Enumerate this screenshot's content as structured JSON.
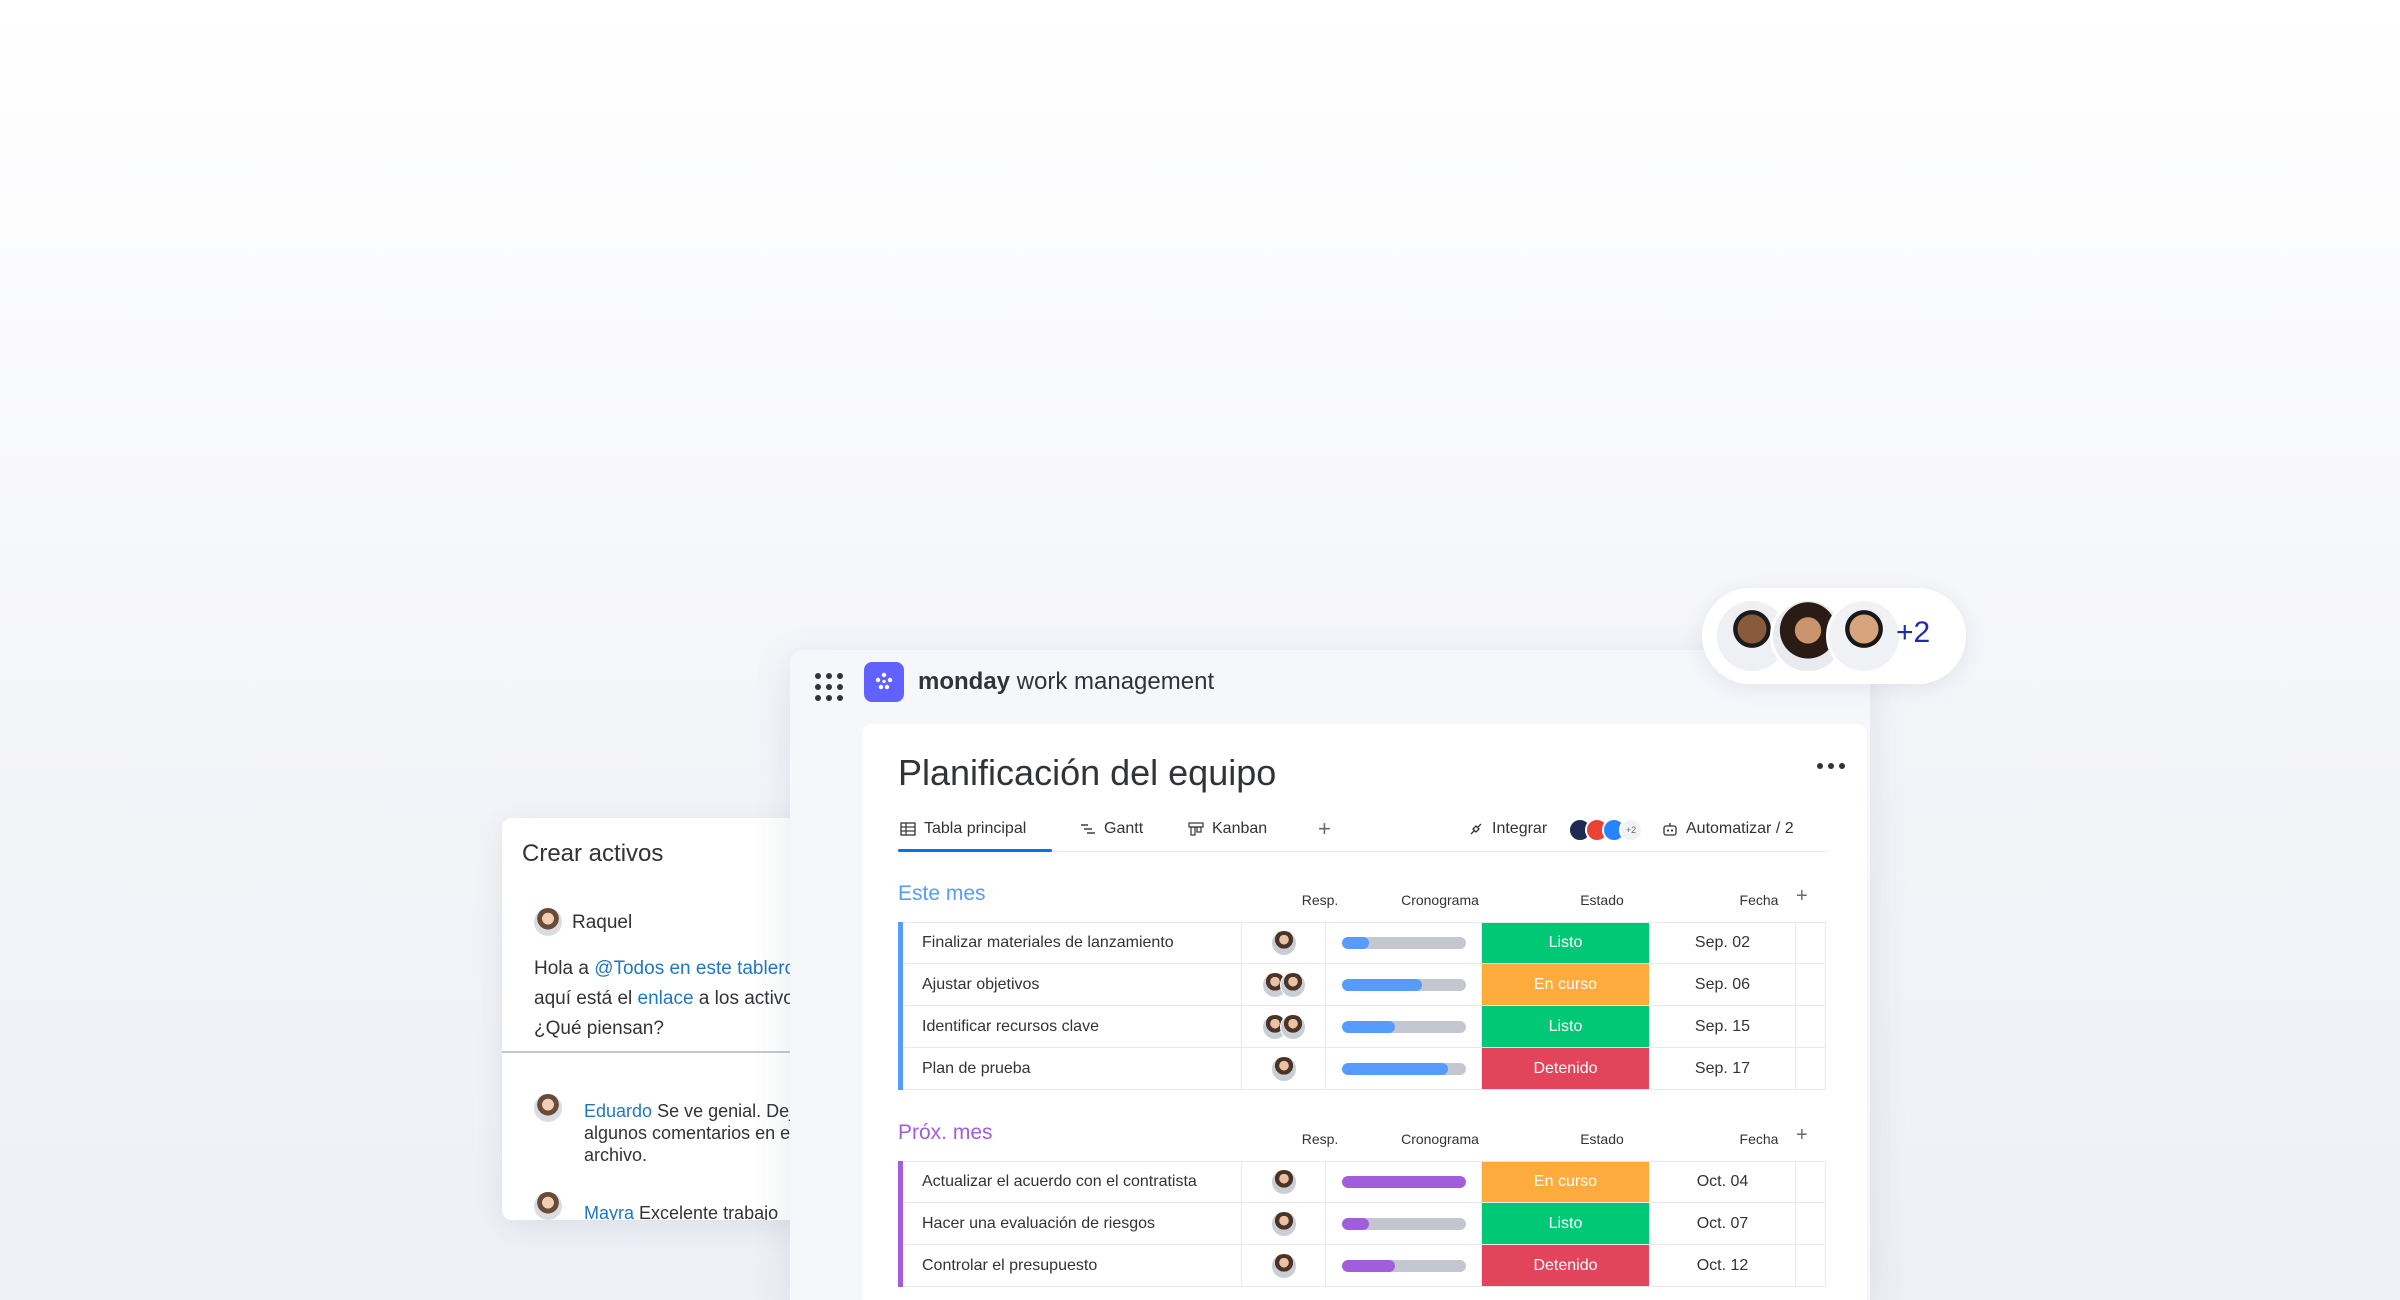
{
  "app": {
    "brand_bold": "monday",
    "brand_rest": " work management",
    "brand_color": "#6161ff"
  },
  "board": {
    "title": "Planificación del equipo",
    "tabs": [
      {
        "label": "Tabla principal",
        "icon": "table-icon",
        "active": true
      },
      {
        "label": "Gantt",
        "icon": "gantt-icon",
        "active": false
      },
      {
        "label": "Kanban",
        "icon": "kanban-icon",
        "active": false
      }
    ],
    "add_tab": "+",
    "integrate_label": "Integrar",
    "integration_extra": "+2",
    "automate_label": "Automatizar / 2",
    "columns": {
      "resp": "Resp.",
      "crono": "Cronograma",
      "estado": "Estado",
      "fecha": "Fecha",
      "add": "+"
    },
    "groups": [
      {
        "title": "Este mes",
        "color": "#579bfc",
        "rows": [
          {
            "name": "Finalizar materiales de lanzamiento",
            "people": 1,
            "progress": 0.22,
            "status": "Listo",
            "status_color": "#00c875",
            "date": "Sep. 02"
          },
          {
            "name": "Ajustar objetivos",
            "people": 2,
            "progress": 0.65,
            "status": "En curso",
            "status_color": "#fdab3d",
            "date": "Sep. 06"
          },
          {
            "name": "Identificar recursos clave",
            "people": 2,
            "progress": 0.43,
            "status": "Listo",
            "status_color": "#00c875",
            "date": "Sep. 15"
          },
          {
            "name": "Plan de prueba",
            "people": 1,
            "progress": 0.86,
            "status": "Detenido",
            "status_color": "#e2445c",
            "date": "Sep. 17"
          }
        ]
      },
      {
        "title": "Próx. mes",
        "color": "#a25ddc",
        "rows": [
          {
            "name": "Actualizar el acuerdo con el contratista",
            "people": 1,
            "progress": 1.0,
            "status": "En curso",
            "status_color": "#fdab3d",
            "date": "Oct. 04"
          },
          {
            "name": "Hacer una evaluación de riesgos",
            "people": 1,
            "progress": 0.22,
            "status": "Listo",
            "status_color": "#00c875",
            "date": "Oct. 07"
          },
          {
            "name": "Controlar el presupuesto",
            "people": 1,
            "progress": 0.43,
            "status": "Detenido",
            "status_color": "#e2445c",
            "date": "Oct. 12"
          }
        ]
      }
    ]
  },
  "chat": {
    "title": "Crear activos",
    "author": "Raquel",
    "message_line1_pre": "Hola a ",
    "message_line1_link": "@Todos en este tablero",
    "message_line2_pre": "aquí está el ",
    "message_line2_link": "enlace",
    "message_line2_post": " a los activos",
    "message_line3": "¿Qué piensan?",
    "replies": [
      {
        "author": "Eduardo",
        "line1": " Se ve genial. Dejé",
        "line2": "algunos comentarios en el",
        "line3": "archivo."
      },
      {
        "author": "Mayra",
        "line1": " Excelente trabajo"
      }
    ]
  },
  "collaborators": {
    "extra_count": "+2"
  }
}
